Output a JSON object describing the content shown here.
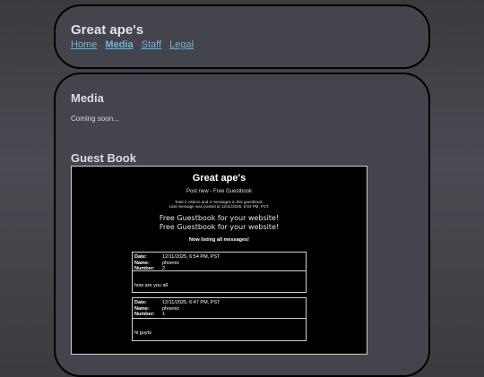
{
  "site": {
    "title": "Great ape's",
    "nav": [
      "Home",
      "Media",
      "Staff",
      "Legal"
    ]
  },
  "media": {
    "heading": "Media",
    "text": "Coming soon..."
  },
  "guestbook": {
    "heading": "Guest Book",
    "site_name": "Great ape's",
    "post_link": "Post new - Free Guestbook",
    "stats_line1": "Total 2 visitors and 2 messages in this guestbook.",
    "stats_line2": "Last message was posted at 12/11/2025, 6:54 PM, PST.",
    "ad_line1": "Free Guestbook for your website!",
    "ad_line2": "Free Guestbook for your website!",
    "listing_label": "Now listing all messages!",
    "labels": {
      "date": "Date:",
      "name": "Name:",
      "number": "Number:"
    },
    "entries": [
      {
        "date": "12/11/2025, 6:54 PM, PST",
        "name": "phoenic",
        "number": "2",
        "message": "how are you all"
      },
      {
        "date": "12/11/2025, 6:47 PM, PST",
        "name": "phoenic",
        "number": "1",
        "message": "hi guyts"
      }
    ]
  },
  "colors": {
    "background": "#3e3e44",
    "panel": "#44444c",
    "link": "#6db6d6",
    "heading_text": "#dcdce0"
  }
}
